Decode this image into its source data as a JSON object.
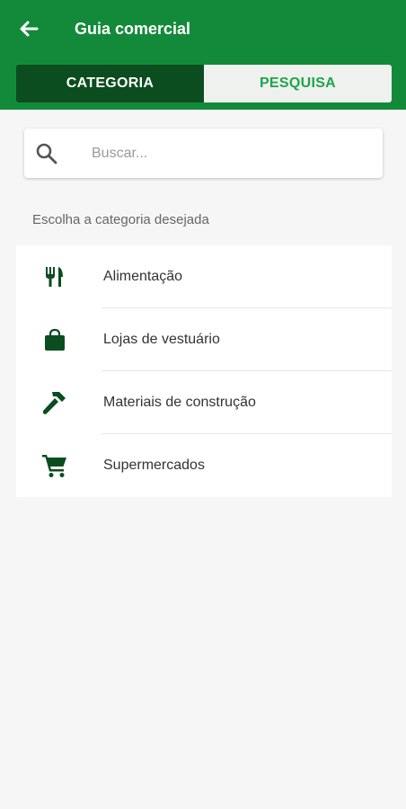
{
  "appbar": {
    "title": "Guia comercial",
    "back_icon": "arrow-left-icon"
  },
  "tabs": [
    {
      "label": "CATEGORIA",
      "active": true
    },
    {
      "label": "PESQUISA",
      "active": false
    }
  ],
  "search": {
    "placeholder": "Buscar...",
    "value": "",
    "icon": "search-icon"
  },
  "section_label": "Escolha a categoria desejada",
  "categories": [
    {
      "label": "Alimentação",
      "icon": "fork-knife-icon"
    },
    {
      "label": "Lojas de vestuário",
      "icon": "shopping-bag-icon"
    },
    {
      "label": "Materiais de construção",
      "icon": "hammer-icon"
    },
    {
      "label": "Supermercados",
      "icon": "shopping-cart-icon"
    }
  ],
  "colors": {
    "primary": "#138a3a",
    "primary_dark": "#0b4d1f",
    "accent_text": "#1fa44c",
    "icon": "#0b4d1f",
    "background": "#f6f6f6"
  }
}
